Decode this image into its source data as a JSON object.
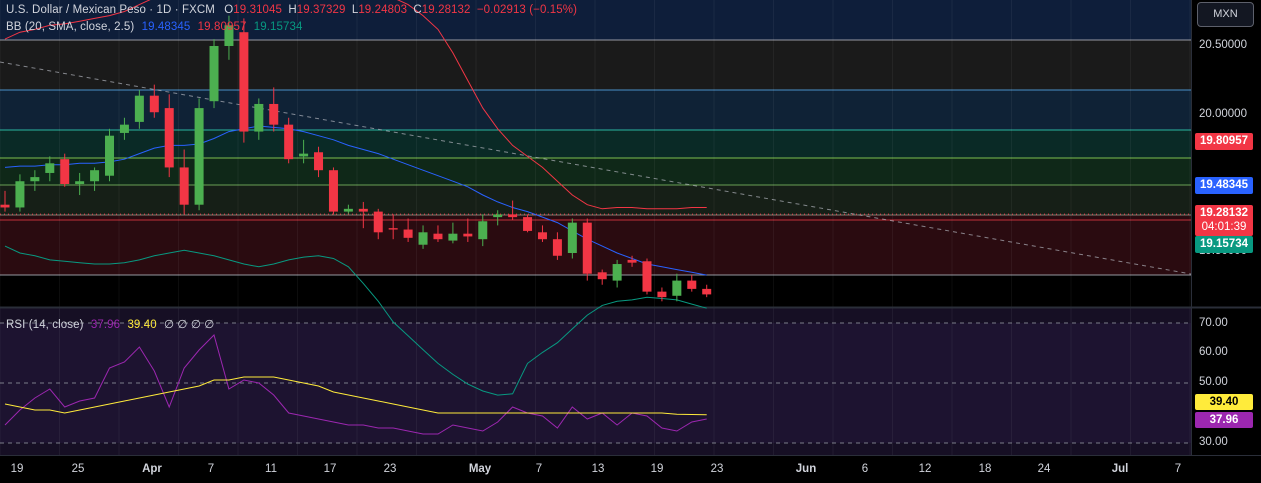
{
  "header": {
    "symbol_title": "U.S. Dollar / Mexican Peso · 1D · FXCM",
    "open_label": "O",
    "open": "19.31045",
    "high_label": "H",
    "high": "19.37329",
    "low_label": "L",
    "low": "19.24803",
    "close_label": "C",
    "close": "19.28132",
    "change": "−0.02913 (−0.15%)"
  },
  "bb_legend": {
    "label": "BB (20, SMA, close, 2.5)",
    "basis": "19.48345",
    "upper": "19.80957",
    "lower": "19.15734"
  },
  "rsi_legend": {
    "label": "RSI (14, close)",
    "rsi": "37.96",
    "ma": "39.40",
    "extras": "∅ ∅ ∅ ∅"
  },
  "currency_button": "MXN",
  "price_axis": {
    "labels": [
      "20.50000",
      "20.00000",
      "19.50000"
    ],
    "badges": {
      "upper": "19.80957",
      "basis": "19.48345",
      "close": "19.28132",
      "countdown": "04:01:39",
      "lower": "19.15734"
    }
  },
  "rsi_axis": {
    "labels": [
      "70.00",
      "60.00",
      "50.00",
      "30.00"
    ],
    "badges": {
      "ma": "39.40",
      "rsi": "37.96"
    }
  },
  "time_axis": {
    "labels": [
      {
        "text": "19",
        "bold": false
      },
      {
        "text": "25",
        "bold": false
      },
      {
        "text": "Apr",
        "bold": true
      },
      {
        "text": "7",
        "bold": false
      },
      {
        "text": "11",
        "bold": false
      },
      {
        "text": "17",
        "bold": false
      },
      {
        "text": "23",
        "bold": false
      },
      {
        "text": "May",
        "bold": true
      },
      {
        "text": "7",
        "bold": false
      },
      {
        "text": "13",
        "bold": false
      },
      {
        "text": "19",
        "bold": false
      },
      {
        "text": "23",
        "bold": false
      },
      {
        "text": "Jun",
        "bold": true
      },
      {
        "text": "6",
        "bold": false
      },
      {
        "text": "12",
        "bold": false
      },
      {
        "text": "18",
        "bold": false
      },
      {
        "text": "24",
        "bold": false
      },
      {
        "text": "Jul",
        "bold": true
      },
      {
        "text": "7",
        "bold": false
      }
    ]
  },
  "colors": {
    "up": "#4caf50",
    "down": "#f23645",
    "bb_basis": "#2962ff",
    "bb_upper": "#f23645",
    "bb_lower": "#089981",
    "rsi": "#9c27b0",
    "rsi_ma": "#ffeb3b",
    "badge_close": "#f23645",
    "badge_basis": "#2962ff",
    "badge_lower": "#089981",
    "badge_ma": "#ffeb3b",
    "badge_rsi": "#9c27b0"
  },
  "chart_data": {
    "type": "candlestick",
    "title": "U.S. Dollar / Mexican Peso · 1D · FXCM",
    "ylim": [
      19.0,
      20.7
    ],
    "candles": [
      {
        "o": 19.35,
        "h": 19.45,
        "l": 19.3,
        "c": 19.33
      },
      {
        "o": 19.33,
        "h": 19.57,
        "l": 19.3,
        "c": 19.52
      },
      {
        "o": 19.52,
        "h": 19.6,
        "l": 19.45,
        "c": 19.55
      },
      {
        "o": 19.58,
        "h": 19.7,
        "l": 19.52,
        "c": 19.65
      },
      {
        "o": 19.68,
        "h": 19.72,
        "l": 19.48,
        "c": 19.5
      },
      {
        "o": 19.5,
        "h": 19.58,
        "l": 19.42,
        "c": 19.52
      },
      {
        "o": 19.52,
        "h": 19.62,
        "l": 19.45,
        "c": 19.6
      },
      {
        "o": 19.56,
        "h": 19.9,
        "l": 19.52,
        "c": 19.85
      },
      {
        "o": 19.87,
        "h": 19.98,
        "l": 19.82,
        "c": 19.93
      },
      {
        "o": 19.95,
        "h": 20.18,
        "l": 19.9,
        "c": 20.14
      },
      {
        "o": 20.14,
        "h": 20.22,
        "l": 19.98,
        "c": 20.02
      },
      {
        "o": 20.05,
        "h": 20.15,
        "l": 19.55,
        "c": 19.62
      },
      {
        "o": 19.62,
        "h": 19.75,
        "l": 19.28,
        "c": 19.35
      },
      {
        "o": 19.35,
        "h": 20.12,
        "l": 19.31,
        "c": 20.05
      },
      {
        "o": 20.1,
        "h": 20.55,
        "l": 20.05,
        "c": 20.5
      },
      {
        "o": 20.5,
        "h": 20.72,
        "l": 20.4,
        "c": 20.65
      },
      {
        "o": 20.6,
        "h": 20.7,
        "l": 19.8,
        "c": 19.88
      },
      {
        "o": 19.88,
        "h": 20.12,
        "l": 19.82,
        "c": 20.08
      },
      {
        "o": 20.08,
        "h": 20.2,
        "l": 19.88,
        "c": 19.93
      },
      {
        "o": 19.93,
        "h": 19.98,
        "l": 19.65,
        "c": 19.68
      },
      {
        "o": 19.7,
        "h": 19.82,
        "l": 19.65,
        "c": 19.72
      },
      {
        "o": 19.73,
        "h": 19.77,
        "l": 19.55,
        "c": 19.6
      },
      {
        "o": 19.6,
        "h": 19.62,
        "l": 19.28,
        "c": 19.3
      },
      {
        "o": 19.3,
        "h": 19.35,
        "l": 19.28,
        "c": 19.32
      },
      {
        "o": 19.32,
        "h": 19.37,
        "l": 19.18,
        "c": 19.3
      },
      {
        "o": 19.3,
        "h": 19.32,
        "l": 19.1,
        "c": 19.15
      },
      {
        "o": 19.18,
        "h": 19.28,
        "l": 19.1,
        "c": 19.17
      },
      {
        "o": 19.17,
        "h": 19.25,
        "l": 19.08,
        "c": 19.11
      },
      {
        "o": 19.06,
        "h": 19.2,
        "l": 19.03,
        "c": 19.15
      },
      {
        "o": 19.14,
        "h": 19.2,
        "l": 19.08,
        "c": 19.1
      },
      {
        "o": 19.09,
        "h": 19.22,
        "l": 19.07,
        "c": 19.14
      },
      {
        "o": 19.14,
        "h": 19.25,
        "l": 19.08,
        "c": 19.12
      },
      {
        "o": 19.1,
        "h": 19.28,
        "l": 19.05,
        "c": 19.23
      },
      {
        "o": 19.26,
        "h": 19.31,
        "l": 19.2,
        "c": 19.28
      },
      {
        "o": 19.28,
        "h": 19.38,
        "l": 19.24,
        "c": 19.26
      },
      {
        "o": 19.26,
        "h": 19.28,
        "l": 19.15,
        "c": 19.16
      },
      {
        "o": 19.15,
        "h": 19.2,
        "l": 19.08,
        "c": 19.1
      },
      {
        "o": 19.1,
        "h": 19.15,
        "l": 18.95,
        "c": 18.98
      },
      {
        "o": 19.0,
        "h": 19.25,
        "l": 18.96,
        "c": 19.22
      },
      {
        "o": 19.22,
        "h": 19.25,
        "l": 18.8,
        "c": 18.85
      },
      {
        "o": 18.86,
        "h": 18.88,
        "l": 18.77,
        "c": 18.81
      },
      {
        "o": 18.8,
        "h": 18.95,
        "l": 18.75,
        "c": 18.92
      },
      {
        "o": 18.95,
        "h": 18.98,
        "l": 18.9,
        "c": 18.93
      },
      {
        "o": 18.94,
        "h": 18.96,
        "l": 18.7,
        "c": 18.72
      },
      {
        "o": 18.72,
        "h": 18.75,
        "l": 18.65,
        "c": 18.68
      },
      {
        "o": 18.69,
        "h": 18.85,
        "l": 18.65,
        "c": 18.8
      },
      {
        "o": 18.8,
        "h": 18.84,
        "l": 18.72,
        "c": 18.74
      },
      {
        "o": 18.74,
        "h": 18.77,
        "l": 18.68,
        "c": 18.7
      }
    ],
    "series": [
      {
        "name": "BB basis",
        "values": [
          19.62,
          19.63,
          19.63,
          19.64,
          19.64,
          19.65,
          19.65,
          19.66,
          19.68,
          19.72,
          19.76,
          19.78,
          19.78,
          19.79,
          19.83,
          19.88,
          19.9,
          19.92,
          19.91,
          19.9,
          19.88,
          19.85,
          19.82,
          19.78,
          19.75,
          19.72,
          19.68,
          19.64,
          19.6,
          19.56,
          19.52,
          19.48,
          19.42,
          19.37,
          19.33,
          19.3,
          19.26,
          19.22,
          19.16,
          19.1,
          19.05,
          19.0,
          18.96,
          18.92,
          18.9,
          18.88,
          18.86,
          18.84
        ]
      },
      {
        "name": "BB upper",
        "values": [
          20.55,
          20.6,
          20.62,
          20.65,
          20.66,
          20.68,
          20.7,
          20.72,
          20.75,
          20.8,
          20.85,
          20.88,
          20.89,
          20.9,
          20.92,
          20.95,
          20.98,
          21.0,
          21.01,
          21.02,
          21.02,
          21.02,
          21.0,
          20.98,
          20.95,
          20.9,
          20.85,
          20.8,
          20.72,
          20.62,
          20.45,
          20.25,
          20.05,
          19.9,
          19.78,
          19.7,
          19.62,
          19.52,
          19.42,
          19.35,
          19.32,
          19.33,
          19.33,
          19.32,
          19.32,
          19.32,
          19.33,
          19.33
        ]
      },
      {
        "name": "BB lower",
        "values": [
          19.05,
          19.0,
          18.98,
          18.95,
          18.94,
          18.93,
          18.92,
          18.92,
          18.93,
          18.95,
          18.98,
          19.0,
          19.02,
          19.0,
          18.98,
          18.95,
          18.92,
          18.9,
          18.92,
          18.95,
          18.97,
          18.98,
          18.96,
          18.9,
          18.78,
          18.65,
          18.5,
          18.4,
          18.3,
          18.2,
          18.12,
          18.05,
          18.0,
          17.97,
          17.98,
          18.2,
          18.28,
          18.35,
          18.45,
          18.55,
          18.62,
          18.65,
          18.66,
          18.68,
          18.67,
          18.66,
          18.63,
          18.6
        ]
      },
      {
        "name": "RSI",
        "values": [
          36,
          41,
          45,
          48,
          42,
          44,
          45,
          55,
          57,
          62,
          54,
          42,
          55,
          61,
          66,
          48,
          51,
          50,
          46,
          40,
          39,
          38,
          37,
          36,
          36,
          35,
          35,
          34,
          33,
          33,
          36,
          35,
          34,
          37,
          42,
          40,
          39,
          35,
          42,
          38,
          40,
          36,
          40,
          39,
          35,
          34,
          37,
          38
        ]
      },
      {
        "name": "RSI MA",
        "values": [
          43,
          42,
          41,
          41,
          40,
          41,
          42,
          43,
          44,
          45,
          46,
          47,
          48,
          49,
          51,
          51,
          52,
          52,
          52,
          51,
          50,
          49,
          47,
          46,
          45,
          44,
          43,
          42,
          41,
          40,
          40,
          40,
          40,
          40,
          40,
          40,
          40,
          40,
          40,
          40,
          40,
          40,
          40,
          40,
          40,
          39.6,
          39.5,
          39.4
        ]
      }
    ],
    "trendline": true
  }
}
